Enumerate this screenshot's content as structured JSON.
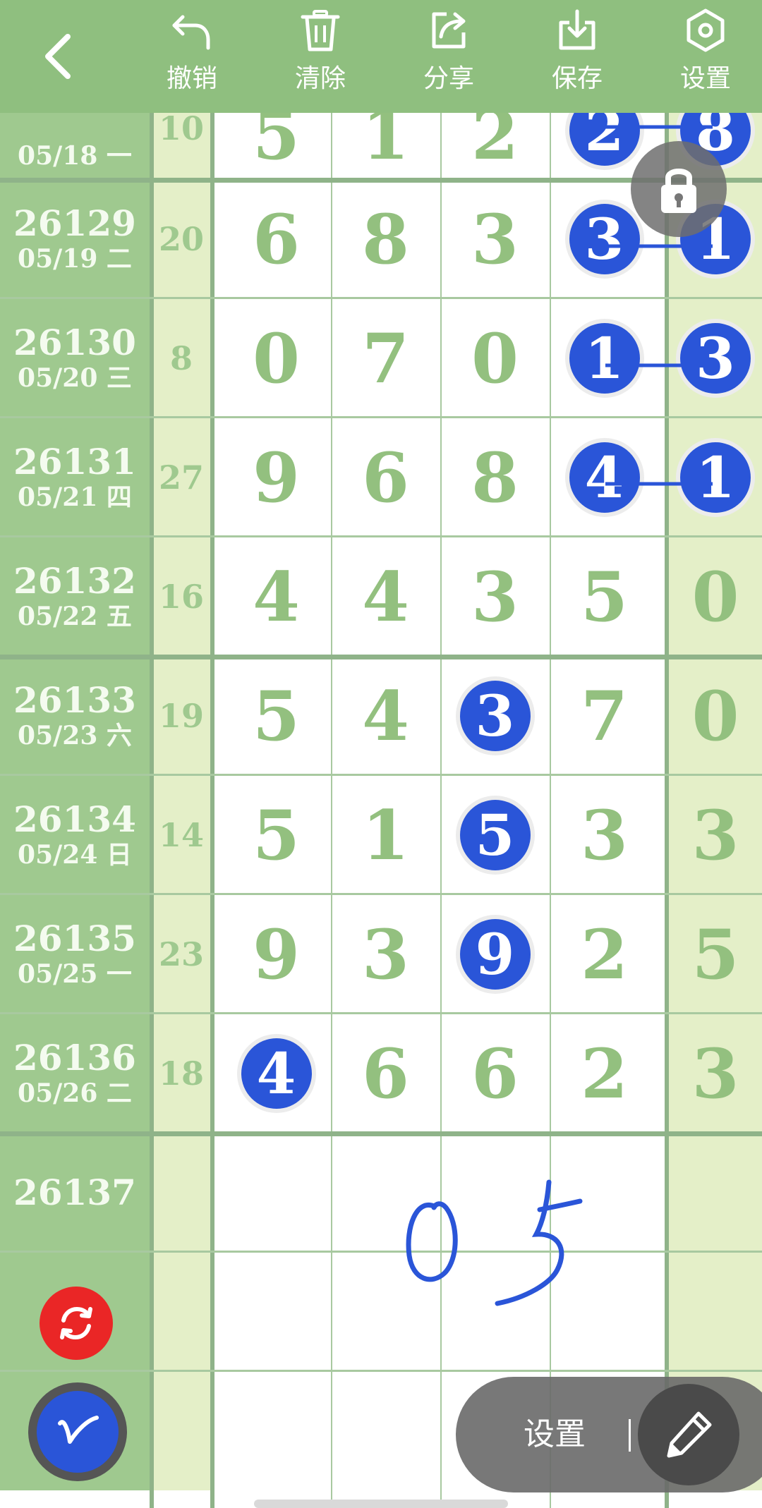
{
  "toolbar": {
    "back_icon": "chevron-left-icon",
    "tools": [
      {
        "label": "撤销",
        "icon": "undo-icon"
      },
      {
        "label": "清除",
        "icon": "trash-icon"
      },
      {
        "label": "分享",
        "icon": "share-icon"
      },
      {
        "label": "保存",
        "icon": "download-icon"
      },
      {
        "label": "设置",
        "icon": "hexagon-settings-icon"
      }
    ]
  },
  "rows": [
    {
      "issue": "",
      "date": "05/18 一",
      "sum": "10",
      "digits": [
        "5",
        "1",
        "2",
        "2",
        "8"
      ]
    },
    {
      "issue": "26129",
      "date": "05/19 二",
      "sum": "20",
      "digits": [
        "6",
        "8",
        "3",
        "3",
        "1"
      ]
    },
    {
      "issue": "26130",
      "date": "05/20 三",
      "sum": "8",
      "digits": [
        "0",
        "7",
        "0",
        "1",
        "3"
      ]
    },
    {
      "issue": "26131",
      "date": "05/21 四",
      "sum": "27",
      "digits": [
        "9",
        "6",
        "8",
        "4",
        "1"
      ]
    },
    {
      "issue": "26132",
      "date": "05/22 五",
      "sum": "16",
      "digits": [
        "4",
        "4",
        "3",
        "5",
        "0"
      ]
    },
    {
      "issue": "26133",
      "date": "05/23 六",
      "sum": "19",
      "digits": [
        "5",
        "4",
        "3",
        "7",
        "0"
      ]
    },
    {
      "issue": "26134",
      "date": "05/24 日",
      "sum": "14",
      "digits": [
        "5",
        "1",
        "5",
        "3",
        "3"
      ]
    },
    {
      "issue": "26135",
      "date": "05/25 一",
      "sum": "23",
      "digits": [
        "9",
        "3",
        "9",
        "2",
        "5"
      ]
    },
    {
      "issue": "26136",
      "date": "05/26 二",
      "sum": "18",
      "digits": [
        "4",
        "6",
        "6",
        "2",
        "3"
      ]
    },
    {
      "issue": "26137",
      "date": "",
      "sum": "",
      "digits": [
        "",
        "",
        "",
        "",
        ""
      ]
    },
    {
      "issue": "",
      "date": "",
      "sum": "",
      "digits": [
        "",
        "",
        "",
        "",
        ""
      ]
    },
    {
      "issue": "",
      "date": "",
      "sum": "",
      "digits": [
        "",
        "",
        "",
        "",
        ""
      ]
    }
  ],
  "highlights": [
    {
      "row": 0,
      "col": 3
    },
    {
      "row": 0,
      "col": 4
    },
    {
      "row": 1,
      "col": 3
    },
    {
      "row": 1,
      "col": 4
    },
    {
      "row": 2,
      "col": 3
    },
    {
      "row": 2,
      "col": 4
    },
    {
      "row": 3,
      "col": 3
    },
    {
      "row": 3,
      "col": 4
    },
    {
      "row": 5,
      "col": 2
    },
    {
      "row": 6,
      "col": 2
    },
    {
      "row": 7,
      "col": 2
    },
    {
      "row": 8,
      "col": 0
    }
  ],
  "handwriting_text": "05",
  "lock_icon": "lock-icon",
  "refresh_icon": "refresh-icon",
  "pen_color_icon": "pen-stroke-icon",
  "bottom_bar": {
    "settings_label": "设置",
    "pen_icon": "pencil-icon"
  },
  "colors": {
    "toolbar": "#8fbf7f",
    "id_column": "#9fc98f",
    "light_column": "#e4efc8",
    "digit": "#93c07f",
    "ball": "#2a55d8",
    "refresh": "#ea2626"
  }
}
